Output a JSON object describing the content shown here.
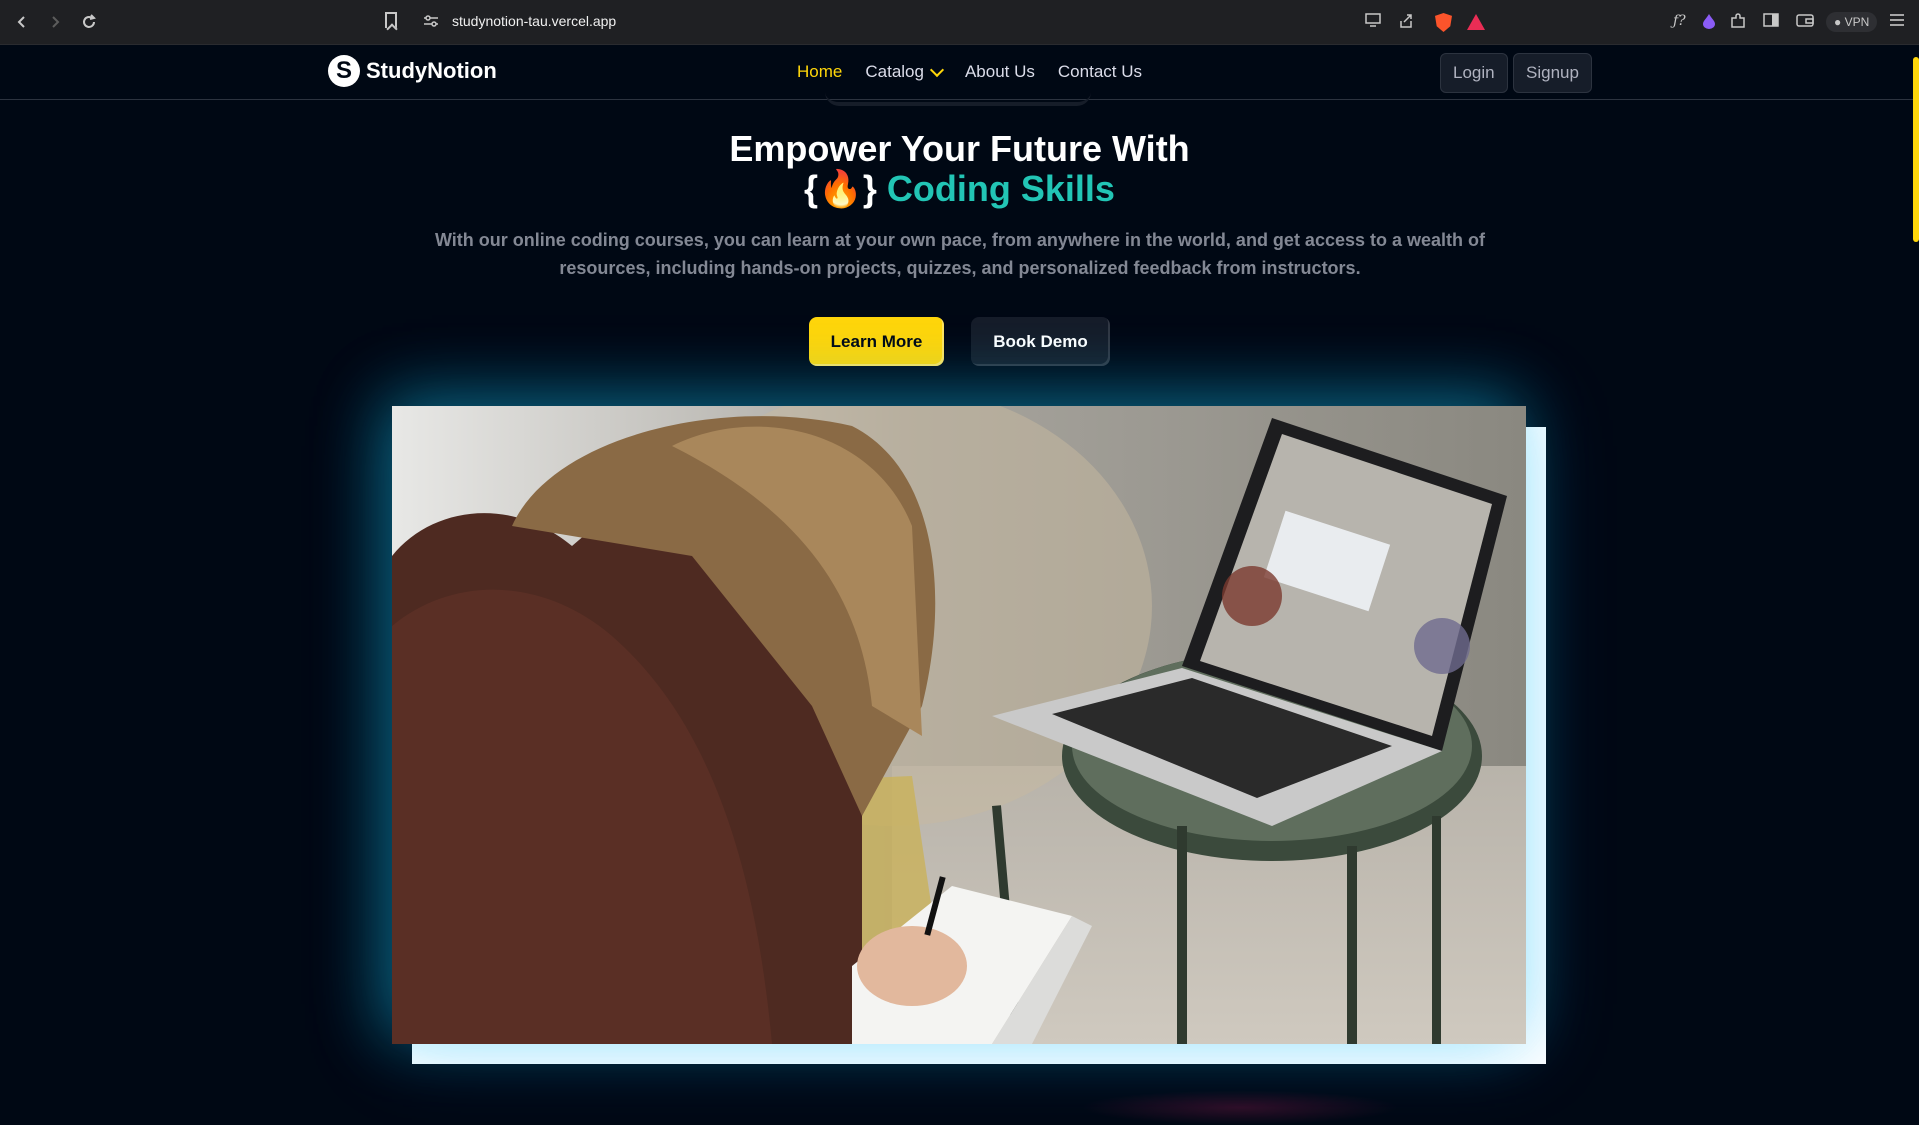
{
  "browser": {
    "url": "studynotion-tau.vercel.app",
    "vpn_label": "VPN",
    "icons": [
      "back-icon",
      "forward-icon",
      "reload-icon",
      "bookmark-icon",
      "site-settings-icon",
      "cast-icon",
      "share-icon",
      "brave-shield-icon",
      "brave-rewards-icon",
      "formula-icon",
      "leo-icon",
      "extensions-icon",
      "sidebar-icon",
      "wallet-icon",
      "menu-icon"
    ]
  },
  "navbar": {
    "logo_text": "StudyNotion",
    "logo_letter": "S",
    "links": [
      "Home",
      "Catalog",
      "About Us",
      "Contact Us"
    ],
    "login": "Login",
    "signup": "Signup"
  },
  "hero": {
    "title_line1": "Empower Your Future With",
    "title_braces_open": "{",
    "title_emoji": "🔥",
    "title_braces_close": "}",
    "title_accent": "Coding Skills",
    "subtitle": "With our online coding courses, you can learn at your own pace, from anywhere in the world, and get access to a wealth of resources, including hands-on projects, quizzes, and personalized feedback from instructors.",
    "learn_more": "Learn More",
    "book_demo": "Book Demo"
  },
  "colors": {
    "background": "#000814",
    "accent_yellow": "#ffd60a",
    "accent_teal": "#22c5b5",
    "muted_text": "#838894"
  }
}
